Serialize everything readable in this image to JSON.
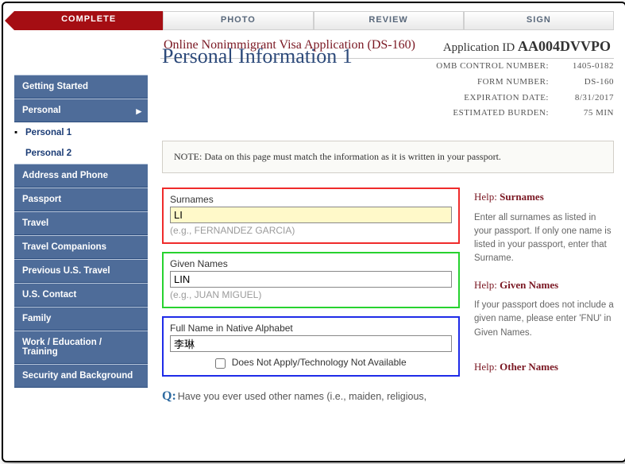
{
  "tabs": [
    "COMPLETE",
    "PHOTO",
    "REVIEW",
    "SIGN"
  ],
  "header": {
    "title": "Online Nonimmigrant Visa Application (DS-160)",
    "appIdLabel": "Application ID",
    "appId": "AA004DVVPO"
  },
  "meta": {
    "ombLabel": "OMB CONTROL NUMBER:",
    "omb": "1405-0182",
    "formLabel": "FORM NUMBER:",
    "form": "DS-160",
    "expLabel": "EXPIRATION DATE:",
    "exp": "8/31/2017",
    "burdenLabel": "ESTIMATED BURDEN:",
    "burden": "75 MIN"
  },
  "pageTitle": "Personal Information 1",
  "sidebar": {
    "items": [
      "Getting Started",
      "Personal",
      "Address and Phone",
      "Passport",
      "Travel",
      "Travel Companions",
      "Previous U.S. Travel",
      "U.S. Contact",
      "Family",
      "Work / Education / Training",
      "Security and Background"
    ],
    "sub": [
      "Personal 1",
      "Personal 2"
    ]
  },
  "note": "NOTE: Data on this page must match the information as it is written in your passport.",
  "fields": {
    "surnames": {
      "label": "Surnames",
      "value": "LI",
      "hint": "(e.g., FERNANDEZ GARCIA)"
    },
    "given": {
      "label": "Given Names",
      "value": "LIN",
      "hint": "(e.g., JUAN MIGUEL)"
    },
    "native": {
      "label": "Full Name in Native Alphabet",
      "value": "李琳",
      "checkbox": "Does Not Apply/Technology Not Available"
    }
  },
  "help": {
    "surnamesTitle": "Surnames",
    "surnamesBody": "Enter all surnames as listed in your passport. If only one name is listed in your passport, enter that Surname.",
    "givenTitle": "Given Names",
    "givenBody": "If your passport does not include a given name, please enter 'FNU' in Given Names.",
    "otherTitle": "Other Names",
    "prefix": "Help:"
  },
  "question": "Have you ever used other names (i.e., maiden, religious,"
}
